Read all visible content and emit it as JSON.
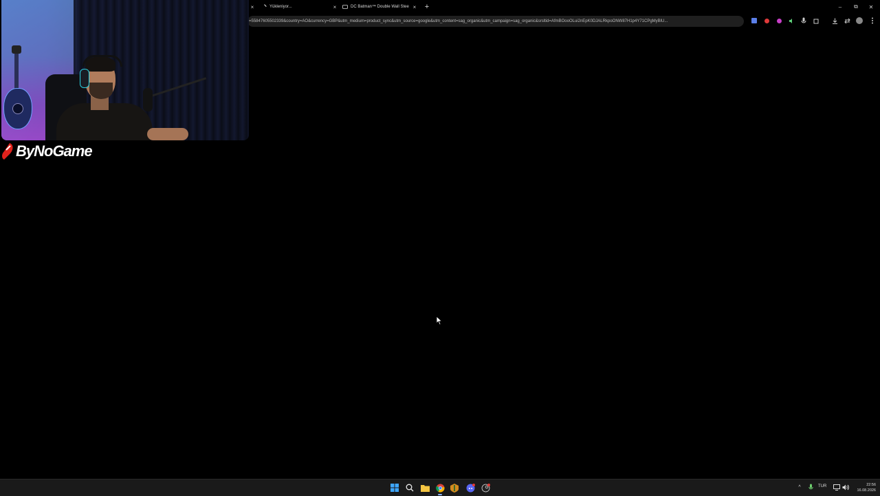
{
  "tabs": [
    {
      "title": "",
      "favicon": "page-icon",
      "close": "×"
    },
    {
      "title": "Yükleniyor...",
      "favicon": "loading-icon",
      "close": "×"
    },
    {
      "title": "DC Batman™ Double Wall Stee",
      "favicon": "tab-group-icon",
      "close": "×"
    }
  ],
  "new_tab_label": "+",
  "address_bar": {
    "url": "=55847605502339&country=AO&currency=GBP&utm_medium=product_sync&utm_source=google&utm_content=sag_organic&utm_campaign=sag_organic&srsltid=AfmBOooOLui2nEpK0DJALRkpoONW87H1p4Y71CPgMyBlU..."
  },
  "window_controls": {
    "minimize": "–",
    "restore": "⧉",
    "close": "✕"
  },
  "extensions": [
    "translate-icon",
    "stop-icon",
    "extension-icon",
    "audio-icon",
    "mic-icon",
    "puzzle-icon"
  ],
  "toolbar_right": [
    "download-icon",
    "sync-icon",
    "profile-avatar",
    "menu-icon"
  ],
  "logo": {
    "text": "ByNoGame"
  },
  "taskbar": {
    "apps": [
      "start-icon",
      "search-icon",
      "file-explorer-icon",
      "chrome-icon",
      "app-icon",
      "discord-icon",
      "steam-icon"
    ],
    "tray_chevron": "^",
    "language": "TUR",
    "time": "22:56",
    "date": "16.08.2026"
  },
  "colors": {
    "accent": "#8ab4f8",
    "logo_red": "#e0221c",
    "taskbar": "#1a1a1a"
  }
}
